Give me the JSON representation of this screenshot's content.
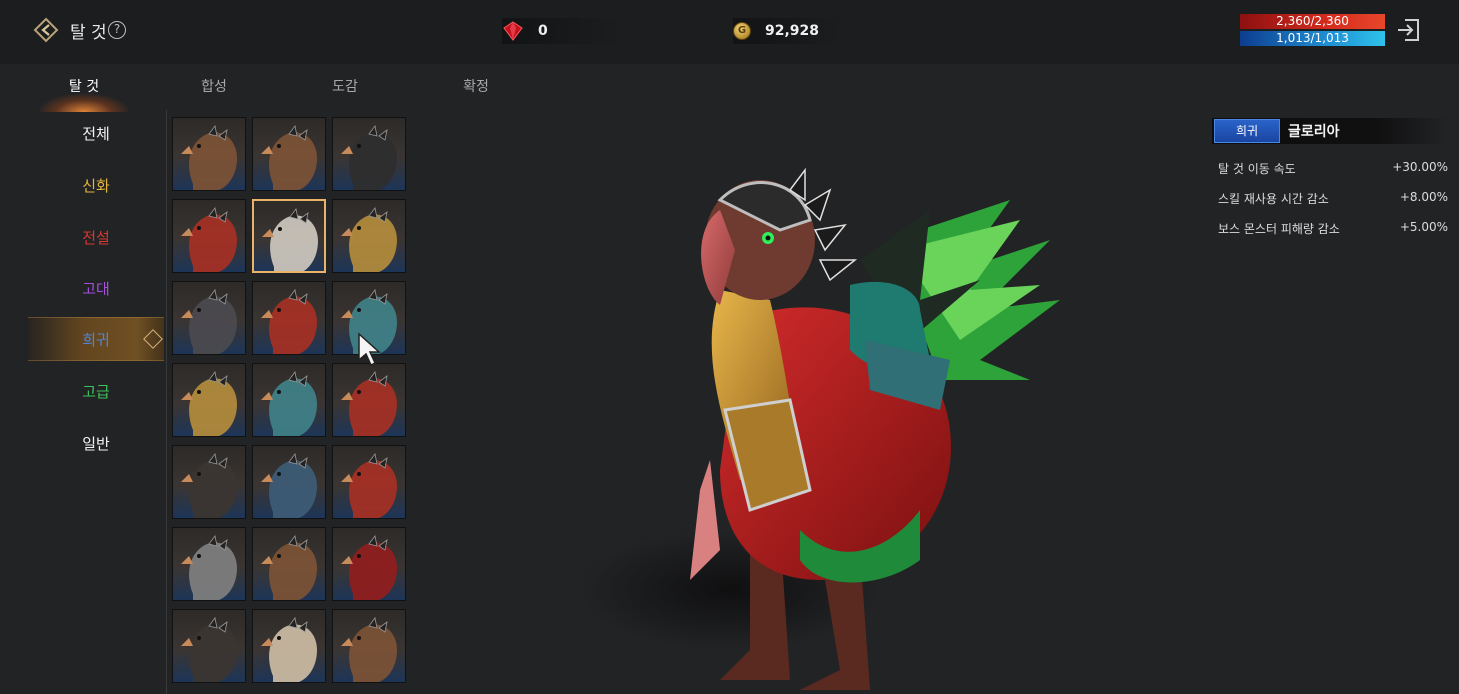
{
  "header": {
    "title": "탈 것",
    "help_icon": "?",
    "gem_count": "0",
    "gold_count": "92,928",
    "hp_text": "2,360/2,360",
    "mp_text": "1,013/1,013",
    "hp_color": "#d42b1e",
    "mp_color": "#1f8ed3"
  },
  "tabs": [
    {
      "label": "탈 것",
      "active": true
    },
    {
      "label": "합성",
      "active": false
    },
    {
      "label": "도감",
      "active": false
    },
    {
      "label": "확정",
      "active": false
    }
  ],
  "categories": [
    {
      "label": "전체",
      "color": "#f2f2f2"
    },
    {
      "label": "신화",
      "color": "#e3b640"
    },
    {
      "label": "전설",
      "color": "#d9382e"
    },
    {
      "label": "고대",
      "color": "#a64fe0"
    },
    {
      "label": "희귀",
      "color": "#4d87e0",
      "active": true
    },
    {
      "label": "고급",
      "color": "#3fc25a"
    },
    {
      "label": "일반",
      "color": "#f2f2f2"
    }
  ],
  "grid": {
    "selected_index": 4,
    "slots": [
      "griffon-brown",
      "hellhound-brown",
      "hellhound-black",
      "cockatrice-red",
      "bear-white",
      "hellhound-gold",
      "wolf-armored",
      "cockatrice-red",
      "cockatrice-teal",
      "eagle-gold",
      "cockatrice-teal",
      "lion-red",
      "eagle-dark",
      "wolf-blue",
      "hellhound-red",
      "hellhound-grey",
      "lion-brown",
      "cockatrice-crimson",
      "bear-dark",
      "bear-pale",
      "griffon-brown"
    ]
  },
  "details": {
    "rarity": "희귀",
    "name": "글로리아",
    "stats": [
      {
        "label": "탈 것 이동 속도",
        "value": "+30.00%"
      },
      {
        "label": "스킬 재사용 시간 감소",
        "value": "+8.00%"
      },
      {
        "label": "보스 몬스터 피해량 감소",
        "value": "+5.00%"
      }
    ]
  }
}
